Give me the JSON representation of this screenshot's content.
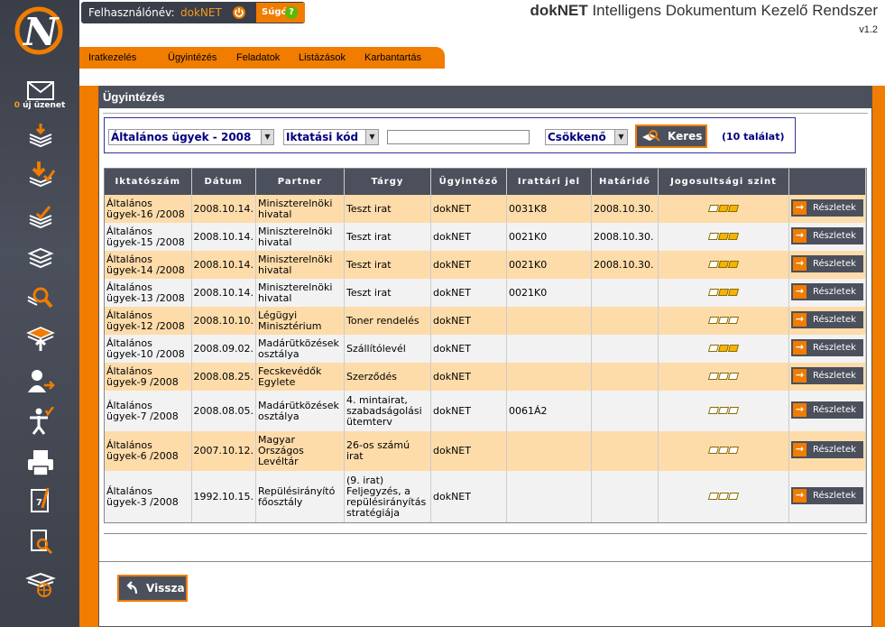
{
  "header": {
    "user_label": "Felhasználónév:",
    "user_name": "dokNET",
    "help_label": "Súgó",
    "app_title_brand": "dokNET",
    "app_title_rest": " Intelligens Dokumentum Kezelő Rendszer",
    "version": "v1.2"
  },
  "sidebar": {
    "message_count": "0",
    "message_label": " új üzenet"
  },
  "nav": [
    "Iratkezelés",
    "Ügyintézés",
    "Feladatok",
    "Listázások",
    "Karbantartás"
  ],
  "panel": {
    "title": "Ügyintézés"
  },
  "search": {
    "category_select": "Általános ügyek - 2008",
    "field_select": "Iktatási kód",
    "query": "",
    "order_select": "Csökkenő",
    "button_label": "Keres",
    "result_count": "(10 találat)"
  },
  "table": {
    "columns": [
      "Iktatószám",
      "Dátum",
      "Partner",
      "Tárgy",
      "Ügyintéző",
      "Irattári jel",
      "Határidő",
      "Jogosultsági szint",
      ""
    ],
    "details_label": "Részletek",
    "rows": [
      {
        "id": "Általános ügyek-16 /2008",
        "date": "2008.10.14.",
        "partner": "Miniszterelnöki hivatal",
        "subject": "Teszt irat",
        "owner": "dokNET",
        "archive": "0031K8",
        "due": "2008.10.30.",
        "level": 2
      },
      {
        "id": "Általános ügyek-15 /2008",
        "date": "2008.10.14.",
        "partner": "Miniszterelnöki hivatal",
        "subject": "Teszt irat",
        "owner": "dokNET",
        "archive": "0021K0",
        "due": "2008.10.30.",
        "level": 2
      },
      {
        "id": "Általános ügyek-14 /2008",
        "date": "2008.10.14.",
        "partner": "Miniszterelnöki hivatal",
        "subject": "Teszt irat",
        "owner": "dokNET",
        "archive": "0021K0",
        "due": "2008.10.30.",
        "level": 2
      },
      {
        "id": "Általános ügyek-13 /2008",
        "date": "2008.10.14.",
        "partner": "Miniszterelnöki hivatal",
        "subject": "Teszt irat",
        "owner": "dokNET",
        "archive": "0021K0",
        "due": "",
        "level": 2
      },
      {
        "id": "Általános ügyek-12 /2008",
        "date": "2008.10.10.",
        "partner": "Légügyi Minisztérium",
        "subject": "Toner rendelés",
        "owner": "dokNET",
        "archive": "",
        "due": "",
        "level": 0
      },
      {
        "id": "Általános ügyek-10 /2008",
        "date": "2008.09.02.",
        "partner": "Madárütközések osztálya",
        "subject": "Szállítólevél",
        "owner": "dokNET",
        "archive": "",
        "due": "",
        "level": 2
      },
      {
        "id": "Általános ügyek-9 /2008",
        "date": "2008.08.25.",
        "partner": "Fecskevédők Egylete",
        "subject": "Szerződés",
        "owner": "dokNET",
        "archive": "",
        "due": "",
        "level": 0
      },
      {
        "id": "Általános ügyek-7 /2008",
        "date": "2008.08.05.",
        "partner": "Madárütközések osztálya",
        "subject": "4. mintairat, szabadságolási ütemterv",
        "owner": "dokNET",
        "archive": "0061Á2",
        "due": "",
        "level": 0
      },
      {
        "id": "Általános ügyek-6 /2008",
        "date": "2007.10.12.",
        "partner": "Magyar Országos Levéltár",
        "subject": "26-os számú irat",
        "owner": "dokNET",
        "archive": "",
        "due": "",
        "level": 0
      },
      {
        "id": "Általános ügyek-3 /2008",
        "date": "1992.10.15.",
        "partner": "Repülésirányító főosztály",
        "subject": "(9. irat) Feljegyzés, a repülésirányítás stratégiája",
        "owner": "dokNET",
        "archive": "",
        "due": "",
        "level": 0
      }
    ]
  },
  "footer": {
    "back_label": "Vissza"
  },
  "colors": {
    "accent": "#f07c00",
    "dark": "#4b505c",
    "row_odd": "#fddcaa",
    "row_even": "#f2f2f2",
    "link": "#000080"
  }
}
